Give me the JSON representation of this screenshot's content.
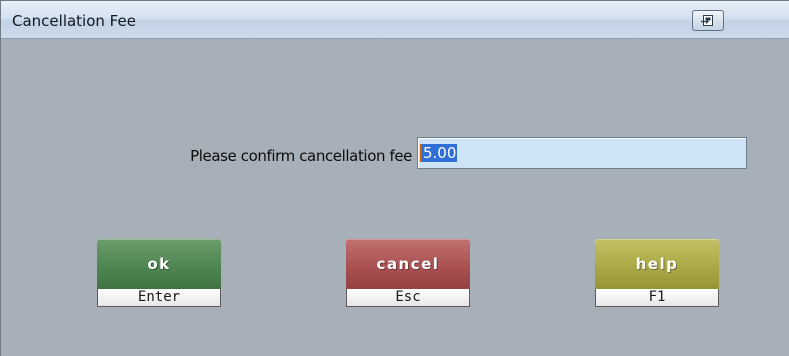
{
  "window": {
    "title": "Cancellation Fee",
    "title_button_icon": "restore-window-icon"
  },
  "form": {
    "prompt_label": "Please confirm cancellation fee",
    "fee_value": "5.00"
  },
  "buttons": {
    "ok": {
      "label": "ok",
      "shortcut": "Enter",
      "color": "#4d8450"
    },
    "cancel": {
      "label": "cancel",
      "shortcut": "Esc",
      "color": "#a84f50"
    },
    "help": {
      "label": "help",
      "shortcut": "F1",
      "color": "#a7a745"
    }
  },
  "colors": {
    "background": "#a7b0b8",
    "input_background": "#cfe3f7",
    "selection": "#2f6fd6"
  }
}
